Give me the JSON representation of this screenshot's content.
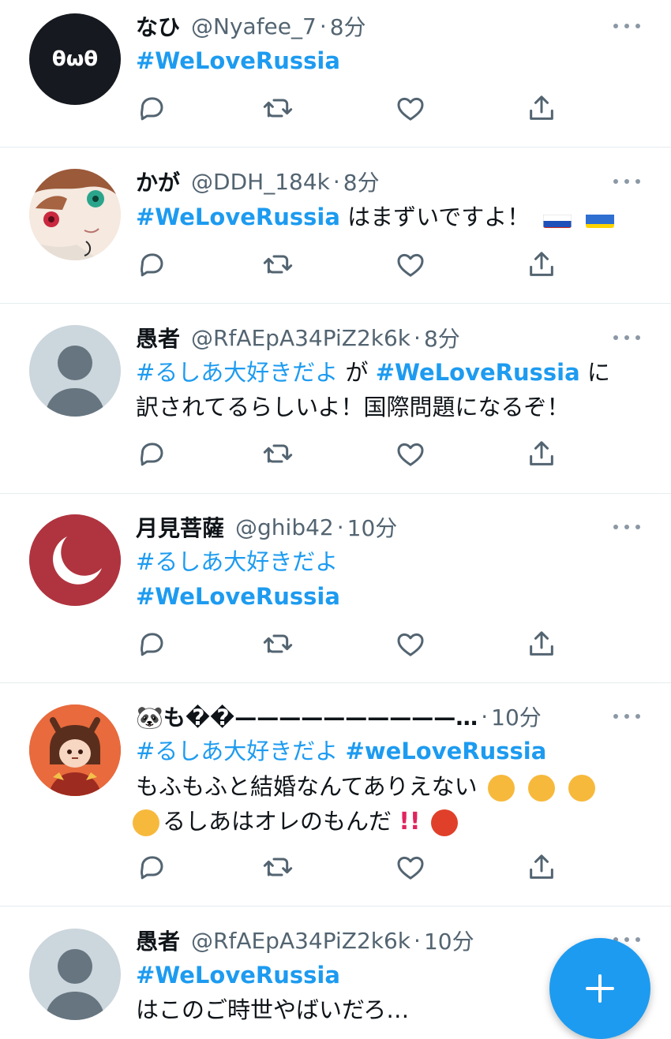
{
  "accent_color": "#1d9bf0",
  "tweets": [
    {
      "username": "なひ",
      "handle": "@Nyafee_7",
      "time": "8分",
      "avatar_text": "θωθ",
      "lines": [
        [
          {
            "text": "#WeLoveRussia",
            "type": "tag-bold"
          }
        ]
      ]
    },
    {
      "username": "かが",
      "handle": "@DDH_184k",
      "time": "8分",
      "lines": [
        [
          {
            "text": "#WeLoveRussia",
            "type": "tag-bold"
          },
          {
            "text": " はまずいですよ！",
            "type": "text"
          }
        ]
      ],
      "flags": [
        "russia-flag",
        "ukraine-flag"
      ]
    },
    {
      "username": "愚者",
      "handle": "@RfAEpA34PiZ2k6k",
      "time": "8分",
      "lines": [
        [
          {
            "text": "#るしあ大好きだよ",
            "type": "tag"
          },
          {
            "text": " が ",
            "type": "text"
          },
          {
            "text": "#WeLoveRussia",
            "type": "tag-bold"
          },
          {
            "text": " に",
            "type": "text"
          }
        ],
        [
          {
            "text": "訳されてるらしいよ！国際問題になるぞ！",
            "type": "text"
          }
        ]
      ]
    },
    {
      "username": "月見菩薩",
      "handle": "@ghib42",
      "time": "10分",
      "lines": [
        [
          {
            "text": "#るしあ大好きだよ",
            "type": "tag"
          }
        ],
        [
          {
            "text": "#WeLoveRussia",
            "type": "tag-bold"
          }
        ]
      ]
    },
    {
      "username": "🐼も��——————————…",
      "handle": "",
      "time": "10分",
      "lines": [
        [
          {
            "text": "#るしあ大好きだよ ",
            "type": "tag"
          },
          {
            "text": "#weLoveRussia",
            "type": "tag-bold"
          }
        ],
        [
          {
            "text": "もふもふと結婚なんてありえない",
            "type": "text"
          }
        ],
        [
          {
            "text": "るしあはオレのもんだ",
            "type": "text"
          }
        ]
      ]
    },
    {
      "username": "愚者",
      "handle": "@RfAEpA34PiZ2k6k",
      "time": "10分",
      "lines": [
        [
          {
            "text": "#WeLoveRussia",
            "type": "tag-bold"
          }
        ],
        [
          {
            "text": "はこのご時世やばいだろ…",
            "type": "text"
          }
        ]
      ]
    }
  ],
  "icons": {
    "reply": "reply-icon",
    "retweet": "retweet-icon",
    "like": "like-icon",
    "share": "share-icon",
    "more": "more-icon",
    "compose": "compose-plus-icon"
  }
}
